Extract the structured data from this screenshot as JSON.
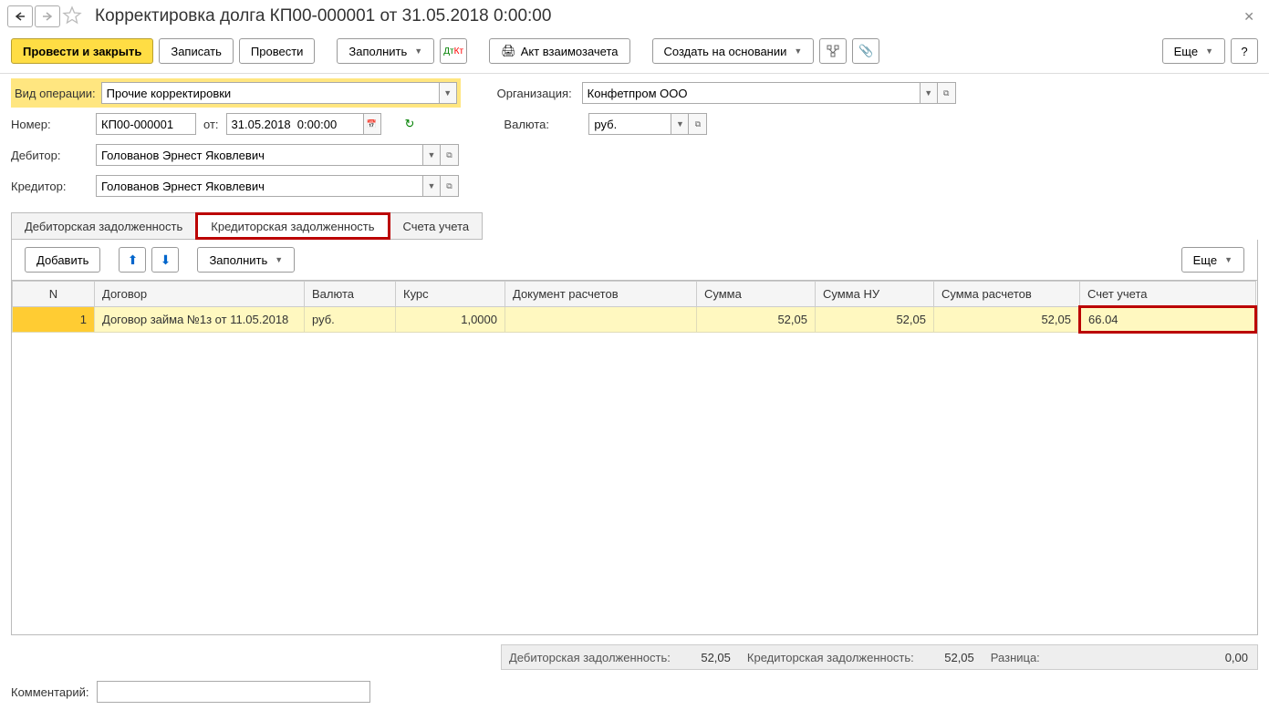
{
  "title": "Корректировка долга КП00-000001 от 31.05.2018 0:00:00",
  "toolbar": {
    "post_close": "Провести и закрыть",
    "save": "Записать",
    "post": "Провести",
    "fill": "Заполнить",
    "act": "Акт взаимозачета",
    "create_based": "Создать на основании",
    "more": "Еще",
    "help": "?"
  },
  "form": {
    "op_label": "Вид операции:",
    "op_value": "Прочие корректировки",
    "org_label": "Организация:",
    "org_value": "Конфетпром ООО",
    "num_label": "Номер:",
    "num_value": "КП00-000001",
    "date_label": "от:",
    "date_value": "31.05.2018  0:00:00",
    "cur_label": "Валюта:",
    "cur_value": "руб.",
    "debtor_label": "Дебитор:",
    "debtor_value": "Голованов Эрнест Яковлевич",
    "creditor_label": "Кредитор:",
    "creditor_value": "Голованов Эрнест Яковлевич"
  },
  "tabs": {
    "t1": "Дебиторская задолженность",
    "t2": "Кредиторская задолженность",
    "t3": "Счета учета"
  },
  "tabToolbar": {
    "add": "Добавить",
    "fill": "Заполнить",
    "more": "Еще"
  },
  "grid": {
    "headers": {
      "n": "N",
      "contract": "Договор",
      "cur": "Валюта",
      "rate": "Курс",
      "doc": "Документ расчетов",
      "sum": "Сумма",
      "sumnu": "Сумма НУ",
      "sumcalc": "Сумма расчетов",
      "account": "Счет учета"
    },
    "row": {
      "n": "1",
      "contract": "Договор займа №1з от 11.05.2018",
      "cur": "руб.",
      "rate": "1,0000",
      "doc": "",
      "sum": "52,05",
      "sumnu": "52,05",
      "sumcalc": "52,05",
      "account": "66.04"
    }
  },
  "totals": {
    "deb_label": "Дебиторская задолженность:",
    "deb_val": "52,05",
    "cred_label": "Кредиторская задолженность:",
    "cred_val": "52,05",
    "diff_label": "Разница:",
    "diff_val": "0,00"
  },
  "comment_label": "Комментарий:"
}
